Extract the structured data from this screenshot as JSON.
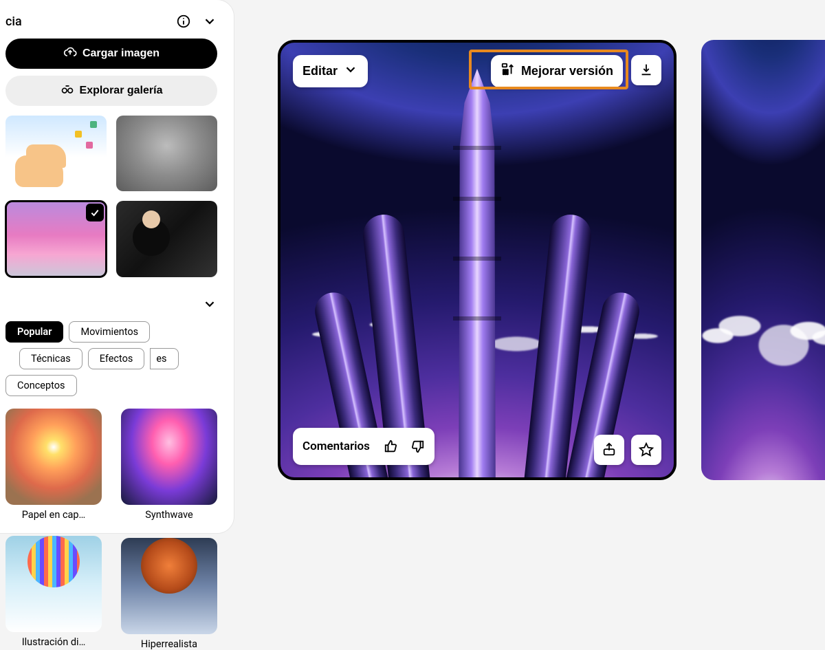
{
  "sidebar": {
    "reference": {
      "title_fragment": "cia",
      "upload_label": "Cargar imagen",
      "explore_label": "Explorar galería",
      "thumbs": [
        {
          "name": "thumb-hand",
          "selected": false
        },
        {
          "name": "thumb-portrait",
          "selected": false
        },
        {
          "name": "thumb-clouds",
          "selected": true
        },
        {
          "name": "thumb-man",
          "selected": false
        }
      ]
    },
    "styles": {
      "tags": [
        {
          "label": "Popular",
          "active": true
        },
        {
          "label": "Movimientos",
          "active": false
        },
        {
          "label": "Técnicas",
          "active": false
        },
        {
          "label": "Efectos",
          "active": false
        },
        {
          "label": "es",
          "active": false,
          "cut": true
        },
        {
          "label": "Conceptos",
          "active": false
        }
      ],
      "items": [
        {
          "label": "Papel en cap…"
        },
        {
          "label": "Synthwave"
        },
        {
          "label": "Ilustración di…"
        },
        {
          "label": "Hiperrealista"
        }
      ]
    }
  },
  "canvas": {
    "edit_label": "Editar",
    "improve_label": "Mejorar versión",
    "comments_label": "Comentarios"
  },
  "colors": {
    "highlight": "#e88a1f"
  }
}
